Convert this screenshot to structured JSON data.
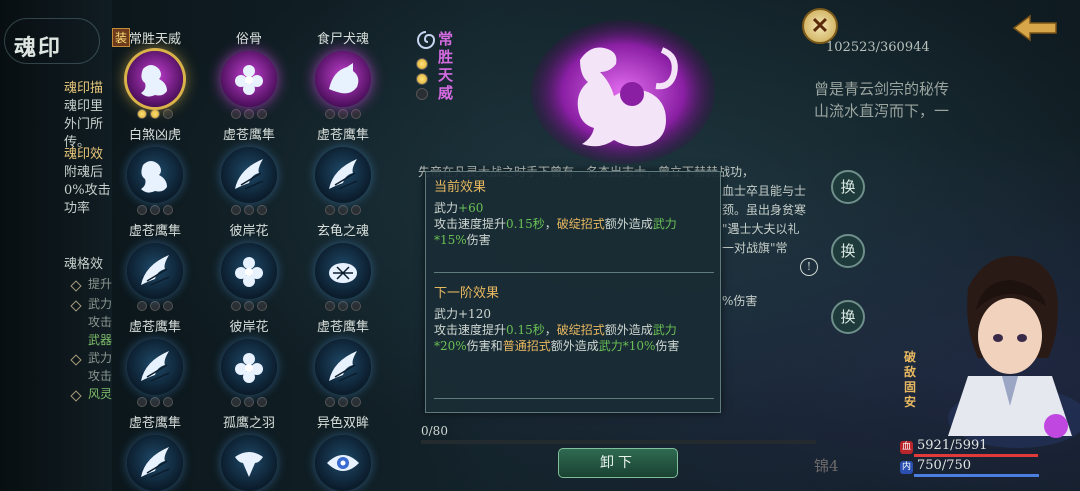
{
  "sidebar": {
    "title": "魂印",
    "intro_head": "魂印描",
    "intro_lines": [
      "魂印里",
      "外门所",
      "传。"
    ],
    "effect_head": "魂印效",
    "effect_lines": [
      "附魂后",
      "0%攻击",
      "功率"
    ],
    "slots_head": "魂格效",
    "slot_lines": [
      "提升",
      "武力",
      "攻击",
      "武器",
      "武力",
      "攻击",
      "风灵"
    ]
  },
  "grid": [
    {
      "name": "常胜天威",
      "dots": 3,
      "filled": 2,
      "variant": "purple-gold",
      "badge": "装",
      "icon": "tiger-icon"
    },
    {
      "name": "俗骨",
      "dots": 3,
      "filled": 0,
      "variant": "purple",
      "icon": "flower-icon"
    },
    {
      "name": "食尸犬魂",
      "dots": 3,
      "filled": 0,
      "variant": "purple",
      "icon": "wolf-icon"
    },
    {
      "name": "白煞凶虎",
      "dots": 3,
      "filled": 0,
      "variant": "blue",
      "icon": "tiger-icon"
    },
    {
      "name": "虚苍鹰隼",
      "dots": 3,
      "filled": 0,
      "variant": "blue",
      "icon": "wing-icon"
    },
    {
      "name": "虚苍鹰隼",
      "dots": 3,
      "filled": 0,
      "variant": "blue",
      "icon": "wing-icon"
    },
    {
      "name": "虚苍鹰隼",
      "dots": 3,
      "filled": 0,
      "variant": "blue",
      "icon": "wing-icon"
    },
    {
      "name": "彼岸花",
      "dots": 3,
      "filled": 0,
      "variant": "blue",
      "icon": "flower-icon"
    },
    {
      "name": "玄龟之魂",
      "dots": 3,
      "filled": 0,
      "variant": "blue",
      "icon": "turtle-icon"
    },
    {
      "name": "虚苍鹰隼",
      "dots": 3,
      "filled": 0,
      "variant": "blue",
      "icon": "wing-icon"
    },
    {
      "name": "彼岸花",
      "dots": 3,
      "filled": 0,
      "variant": "blue",
      "icon": "flower-icon"
    },
    {
      "name": "虚苍鹰隼",
      "dots": 3,
      "filled": 0,
      "variant": "blue",
      "icon": "wing-icon"
    },
    {
      "name": "虚苍鹰隼",
      "dots": 3,
      "filled": 0,
      "variant": "blue",
      "icon": "wing-icon"
    },
    {
      "name": "孤鹰之羽",
      "dots": 3,
      "filled": 0,
      "variant": "blue",
      "icon": "eagle-icon"
    },
    {
      "name": "异色双眸",
      "dots": 3,
      "filled": 0,
      "variant": "blue",
      "icon": "eye-icon"
    }
  ],
  "detail": {
    "name": "常胜天威",
    "level_dots": 3,
    "level_filled": 2,
    "description": "先帝在凡灵大战之时手下曾有一名杰出志士，曾立下赫赫战功，",
    "progress": "0/80",
    "progress_fraction": 0,
    "unload_label": "卸下"
  },
  "tooltip": {
    "current_title": "当前效果",
    "current_stat_name": "武力",
    "current_stat_value": "+60",
    "current_line_a": "攻击速度提升",
    "current_speed": "0.15秒",
    "current_line_b": "，",
    "current_skill": "破绽招式",
    "current_line_c": "额外造成",
    "current_dmg_stat": "武力",
    "current_pct": "*15%",
    "current_line_d": "伤害",
    "next_title": "下一阶效果",
    "next_stat": "武力+120",
    "next_line_a": "攻击速度提升",
    "next_speed": "0.15秒",
    "next_line_b": "，",
    "next_skill": "破绽招式",
    "next_line_c": "额外造成",
    "next_dmg_stat": "武力",
    "next_pct": "*20%",
    "next_line_d": "伤害和",
    "next_skill2": "普通招式",
    "next_line_e": "额外造成",
    "next_dmg_stat2": "武力",
    "next_pct2": "*10%",
    "next_line_f": "伤害"
  },
  "right": {
    "score": "102523/360944",
    "lore_lines": [
      "曾是青云剑宗的秘传",
      "山流水直泻而下，一"
    ],
    "swap_label": "换",
    "info_label": "!",
    "side_text_a": "血士卒且能与士",
    "side_text_b": "颈。虽出身贫寒",
    "side_text_c": "\"遇士大夫以礼",
    "side_text_d": "一对战旗\"常",
    "side_text_e": "%伤害",
    "faded_bottom": "锦4"
  },
  "character": {
    "name": "破敌固安",
    "hp": "5921/5991",
    "hp_fraction": 0.988,
    "mp": "750/750",
    "mp_fraction": 1,
    "hp_icon": "血",
    "mp_icon": "内"
  },
  "colors": {
    "accent_purple": "#d46be0",
    "effect_green": "#6ac055",
    "effect_gold": "#e8b860"
  }
}
